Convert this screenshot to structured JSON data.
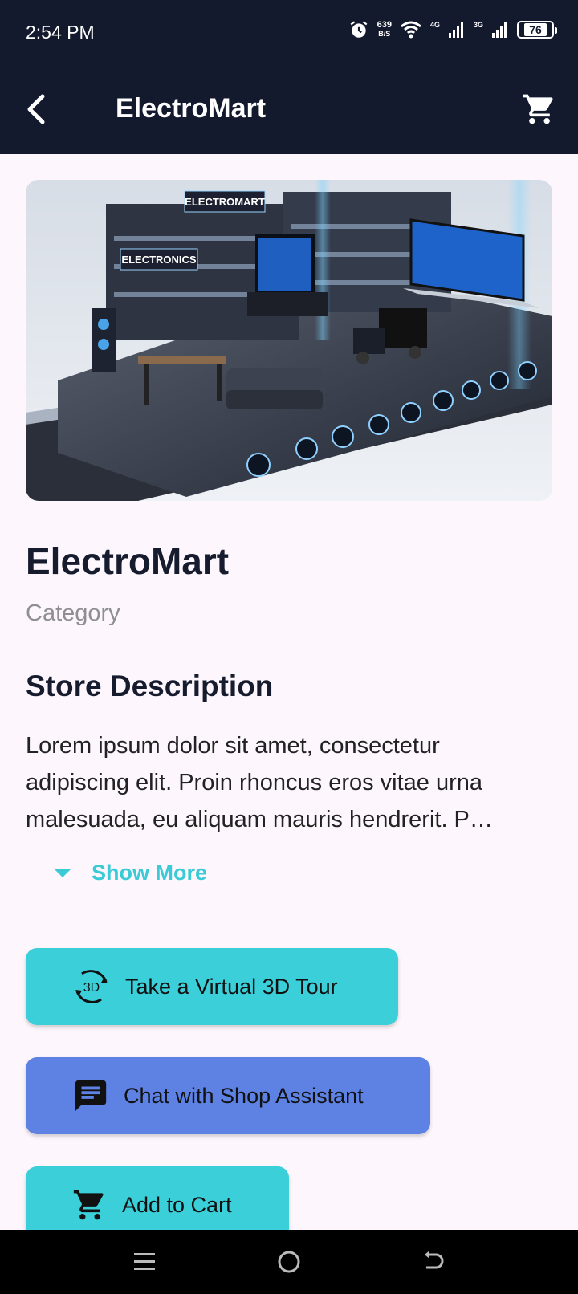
{
  "status_bar": {
    "time": "2:54 PM",
    "net_speed_value": "639",
    "net_speed_unit": "B/S",
    "signal_1_label": "4G",
    "signal_2_label": "3G",
    "battery": "76"
  },
  "app_bar": {
    "title": "ElectroMart",
    "back_icon": "arrow-back-icon",
    "cart_icon": "shopping-cart-icon"
  },
  "hero": {
    "signs": [
      "ELECTROMART",
      "ELECTRONICS"
    ]
  },
  "store": {
    "name": "ElectroMart",
    "category": "Category",
    "description_title": "Store Description",
    "description_lines": [
      "Lorem ipsum dolor sit amet, consectetur",
      "adipiscing elit. Proin rhoncus eros vitae urna",
      "malesuada, eu aliquam mauris hendrerit. P…"
    ],
    "show_more": "Show More"
  },
  "actions": {
    "tour": "Take a Virtual 3D Tour",
    "tour_icon_text": "3D",
    "chat": "Chat with Shop Assistant",
    "cart": "Add to Cart"
  },
  "colors": {
    "app_bar": "#141A2E",
    "accent": "#3ACFD9",
    "chat": "#5E82E3",
    "background": "#FDF7FD"
  }
}
